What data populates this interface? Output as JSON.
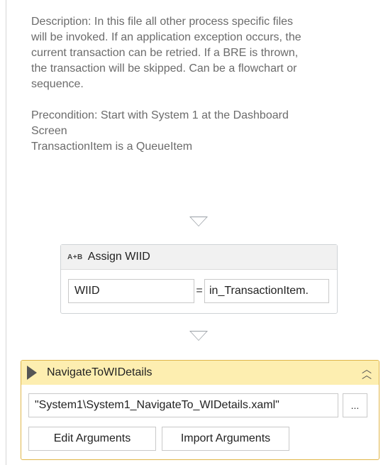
{
  "annotation": {
    "description": "Description: In this file all other process specific files\nwill be invoked. If an application exception occurs, the\ncurrent transaction can be retried. If a BRE is thrown,\nthe transaction will be skipped. Can be a flowchart or\nsequence.",
    "precondition": "Precondition: Start with System 1 at the Dashboard\nScreen\nTransactionItem is a QueueItem"
  },
  "assign": {
    "icon": "A+B",
    "title": "Assign WIID",
    "to": "WIID",
    "operator": "=",
    "value": "in_TransactionItem."
  },
  "invoke": {
    "title": "NavigateToWIDetails",
    "file_path": "\"System1\\System1_NavigateTo_WIDetails.xaml\"",
    "browse_label": "...",
    "edit_arguments_label": "Edit Arguments",
    "import_arguments_label": "Import Arguments"
  },
  "colors": {
    "invoke_header_bg": "#fdeeb0",
    "invoke_border": "#e0b64a",
    "connector_arrow": "#9aa0a6"
  }
}
